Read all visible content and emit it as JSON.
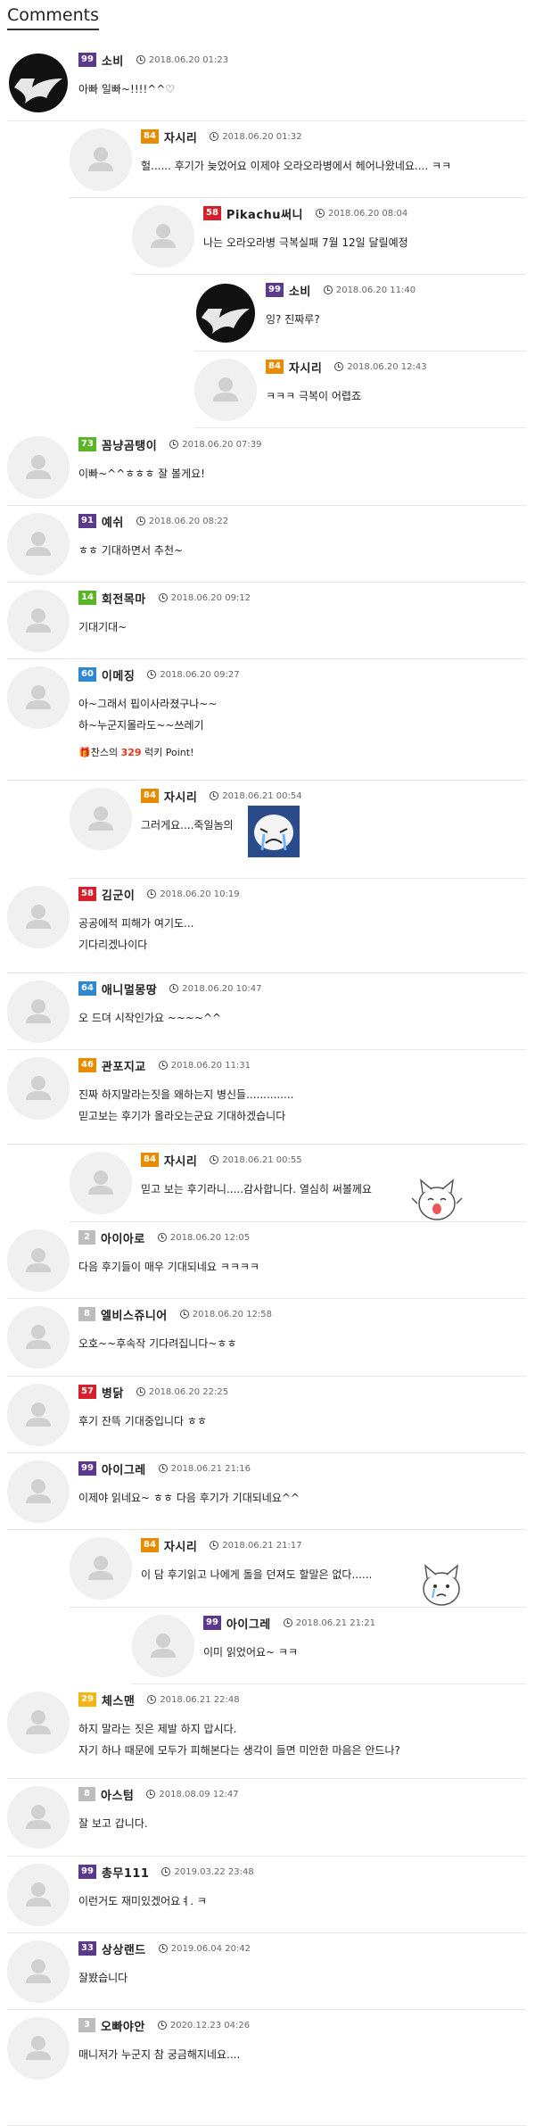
{
  "header": {
    "title": "Comments"
  },
  "level_colors": {
    "99": "#5b3a8c",
    "84": "#e78c00",
    "58": "#d8202d",
    "73": "#5cb528",
    "91": "#5b3a8c",
    "14": "#5cb528",
    "60": "#2f87d0",
    "64": "#2f87d0",
    "46": "#e78c00",
    "2": "#bdbdbd",
    "8": "#bdbdbd",
    "57": "#d8202d",
    "29": "#f3b50e",
    "33": "#5b3a8c",
    "3": "#bdbdbd"
  },
  "comments": [
    {
      "level": "99",
      "nick": "소비",
      "date": "2018.06.20 01:23",
      "text": "아빠 일빠~!!!!^^♡",
      "avatar": "black-swirl-avatar"
    },
    {
      "level": "84",
      "nick": "자시리",
      "date": "2018.06.20 01:32",
      "text": "헐...... 후기가 늦었어요 이제야 오라오라병에서 헤어나왔네요.... ㅋㅋ",
      "avatar": "default-user-avatar"
    },
    {
      "level": "58",
      "nick": "Pikachu써니",
      "date": "2018.06.20 08:04",
      "text": "나는 오라오라병 극복실패 7월 12일 달릴예정",
      "avatar": "default-user-avatar"
    },
    {
      "level": "99",
      "nick": "소비",
      "date": "2018.06.20 11:40",
      "text": "잉? 진짜루?",
      "avatar": "black-swirl-avatar"
    },
    {
      "level": "84",
      "nick": "자시리",
      "date": "2018.06.20 12:43",
      "text": "ㅋㅋㅋ 극복이 어렵죠",
      "avatar": "default-user-avatar"
    },
    {
      "level": "73",
      "nick": "꼼냥곰탱이",
      "date": "2018.06.20 07:39",
      "text": "이빠~^^ㅎㅎㅎ 잘 볼게요!",
      "avatar": "default-user-avatar"
    },
    {
      "level": "91",
      "nick": "예쉬",
      "date": "2018.06.20 08:22",
      "text": "ㅎㅎ 기대하면서 추천~",
      "avatar": "default-user-avatar"
    },
    {
      "level": "14",
      "nick": "회전목마",
      "date": "2018.06.20 09:12",
      "text": "기대기대~",
      "avatar": "default-user-avatar"
    },
    {
      "level": "60",
      "nick": "이메징",
      "date": "2018.06.20 09:27",
      "text": "아~그래서 핍이사라졌구나~~\n하~누군지몰라도~~쓰레기",
      "luck_prefix": "찬스의",
      "luck_value": "329",
      "luck_suffix": "럭키 Point!",
      "avatar": "default-user-avatar"
    },
    {
      "level": "84",
      "nick": "자시리",
      "date": "2018.06.21 00:54",
      "text": "그러게요....죽일놈의",
      "avatar": "default-user-avatar",
      "sticker": "crying-face-sticker"
    },
    {
      "level": "58",
      "nick": "김군이",
      "date": "2018.06.20 10:19",
      "text": "공공에적 피해가 여기도...\n기다리겠나이다",
      "avatar": "default-user-avatar"
    },
    {
      "level": "64",
      "nick": "애니멀몽땅",
      "date": "2018.06.20 10:47",
      "text": "오 드뎌 시작인가요 ~~~~^^",
      "avatar": "default-user-avatar"
    },
    {
      "level": "46",
      "nick": "관포지교",
      "date": "2018.06.20 11:31",
      "text": "진짜 하지말라는짓을 왜하는지 병신들..............\n믿고보는 후기가 올라오는군요 기대하겠습니다",
      "avatar": "default-user-avatar"
    },
    {
      "level": "84",
      "nick": "자시리",
      "date": "2018.06.21 00:55",
      "text": "믿고 보는 후기라니.....감사합니다. 열심히 써볼께요",
      "avatar": "default-user-avatar",
      "sticker": "happy-cat-sticker"
    },
    {
      "level": "2",
      "nick": "아이아로",
      "date": "2018.06.20 12:05",
      "text": "다음 후기들이 매우 기대되네요 ㅋㅋㅋㅋ",
      "avatar": "default-user-avatar"
    },
    {
      "level": "8",
      "nick": "엘비스쥬니어",
      "date": "2018.06.20 12:58",
      "text": "오호~~후속작 기다려집니다~ㅎㅎ",
      "avatar": "default-user-avatar"
    },
    {
      "level": "57",
      "nick": "병닭",
      "date": "2018.06.20 22:25",
      "text": "후기 잔뜩 기대중입니다 ㅎㅎ",
      "avatar": "default-user-avatar"
    },
    {
      "level": "99",
      "nick": "아이그레",
      "date": "2018.06.21 21:16",
      "text": "이제야 읽네요~ ㅎㅎ 다음 후기가 기대되네요^^",
      "avatar": "default-user-avatar"
    },
    {
      "level": "84",
      "nick": "자시리",
      "date": "2018.06.21 21:17",
      "text": "이 담 후기읽고 나에게 돌을 던져도 할말은 없다......",
      "avatar": "default-user-avatar",
      "sticker": "sad-cat-sticker"
    },
    {
      "level": "99",
      "nick": "아이그레",
      "date": "2018.06.21 21:21",
      "text": "이미 읽었어요~ ㅋㅋ",
      "avatar": "default-user-avatar"
    },
    {
      "level": "29",
      "nick": "체스맨",
      "date": "2018.06.21 22:48",
      "text": "하지 말라는 짓은 제발 하지 맙시다.\n자기 하나 때문에 모두가 피해본다는 생각이 들면 미안한 마음은 안드나?",
      "avatar": "default-user-avatar"
    },
    {
      "level": "8",
      "nick": "아스텀",
      "date": "2018.08.09 12:47",
      "text": "잘 보고 갑니다.",
      "avatar": "default-user-avatar"
    },
    {
      "level": "99",
      "nick": "총무111",
      "date": "2019.03.22 23:48",
      "text": "이런거도 재미있겠어요ㅕ. ㅋ",
      "avatar": "default-user-avatar"
    },
    {
      "level": "33",
      "nick": "상상랜드",
      "date": "2019.06.04 20:42",
      "text": "잘봤습니다",
      "avatar": "default-user-avatar"
    },
    {
      "level": "3",
      "nick": "오빠야안",
      "date": "2020.12.23 04:26",
      "text": "매니저가 누군지 참 궁금해지네요....",
      "avatar": "default-user-avatar"
    }
  ]
}
